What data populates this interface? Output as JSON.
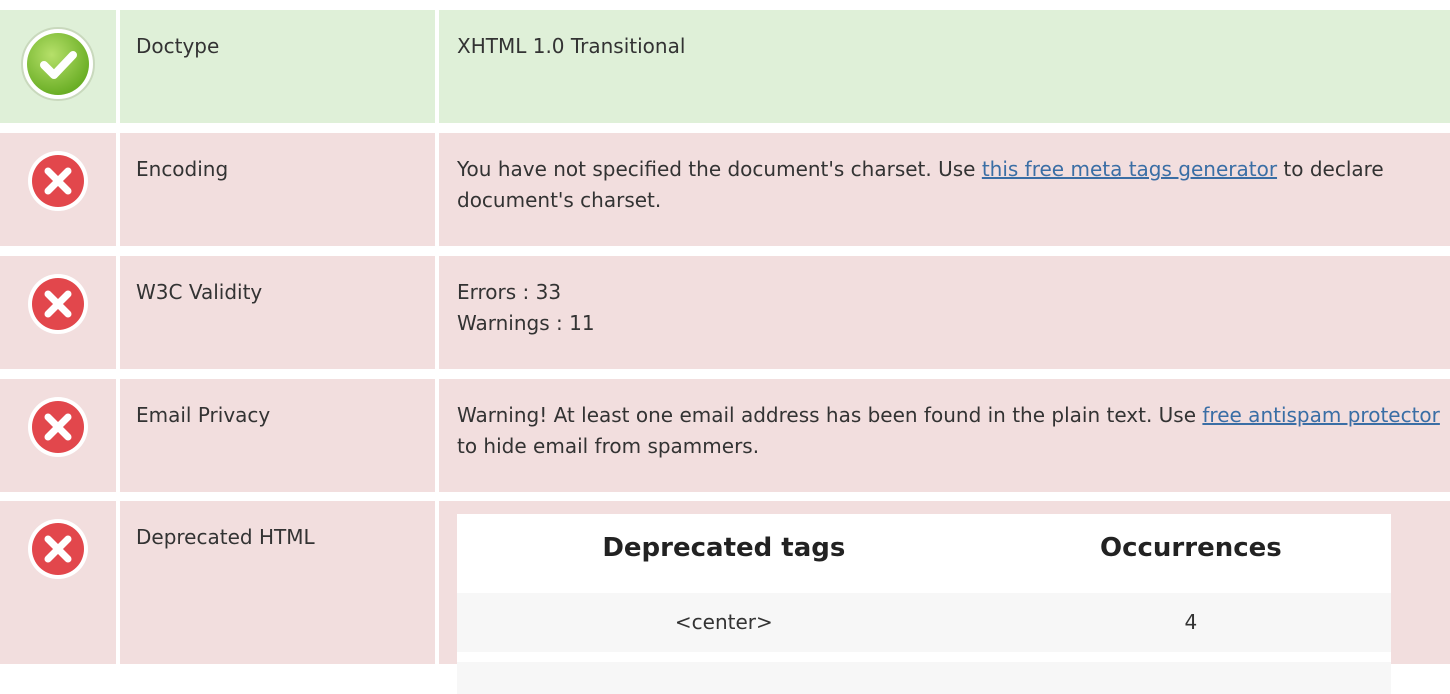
{
  "rows": [
    {
      "status": "pass",
      "icon": "check-icon",
      "label": "Doctype",
      "value": "XHTML 1.0 Transitional"
    },
    {
      "status": "fail",
      "icon": "error-icon",
      "label": "Encoding",
      "text_before": "You have not specified the document's charset. Use ",
      "link": "this free meta tags generator",
      "text_after": " to declare document's charset."
    },
    {
      "status": "fail",
      "icon": "error-icon",
      "label": "W3C Validity",
      "errors": "Errors : 33",
      "warnings": "Warnings : 11"
    },
    {
      "status": "fail",
      "icon": "error-icon",
      "label": "Email Privacy",
      "text_before": "Warning! At least one email address has been found in the plain text. Use ",
      "link": "free antispam protector",
      "text_after": " to hide email from spammers."
    },
    {
      "status": "fail",
      "icon": "error-icon",
      "label": "Deprecated HTML",
      "table": {
        "headers": [
          "Deprecated tags",
          "Occurrences"
        ],
        "rows": [
          [
            "<center>",
            "4"
          ]
        ]
      }
    }
  ],
  "colors": {
    "pass_bg": "#dff0d8",
    "fail_bg": "#f2dede",
    "check_green": "#7cbf3a",
    "error_red": "#e2474c",
    "link": "#3a6ea5"
  }
}
